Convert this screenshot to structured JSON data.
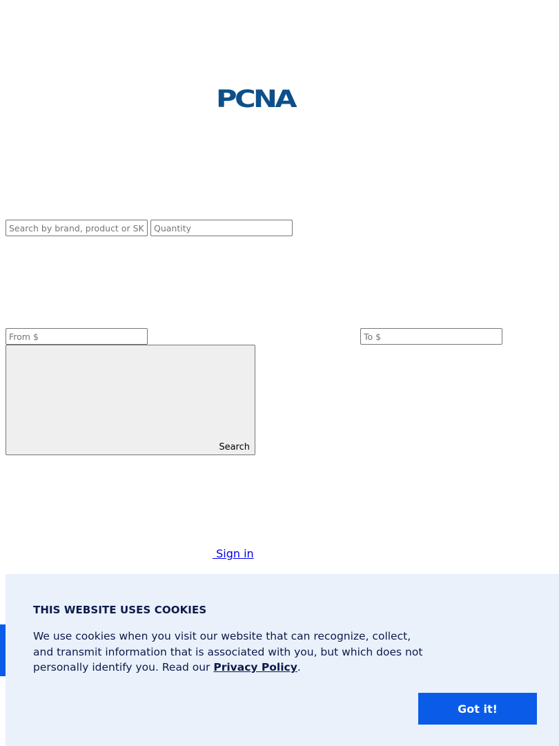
{
  "header": {
    "logo_text": "PCNA",
    "logo_trademark": "™",
    "logo_color": "#0d4f8a"
  },
  "search": {
    "keyword_placeholder": "Search by brand, product or SKU",
    "quantity_placeholder": "Quantity",
    "price_from_placeholder": "From $",
    "price_to_placeholder": "To $",
    "button_label": "Search"
  },
  "account": {
    "signin_label": " Sign in"
  },
  "cookie_banner": {
    "title": "THIS WEBSITE USES COOKIES",
    "body_text": "We use cookies when you visit our website that can recognize, collect, and transmit information that is associated with you, but which does not personally identify you. Read our ",
    "policy_link": "Privacy Policy",
    "body_end": ".",
    "accept_label": "Got it!",
    "accent_color": "#0a5ce8",
    "background_color": "#eaf1fb"
  }
}
